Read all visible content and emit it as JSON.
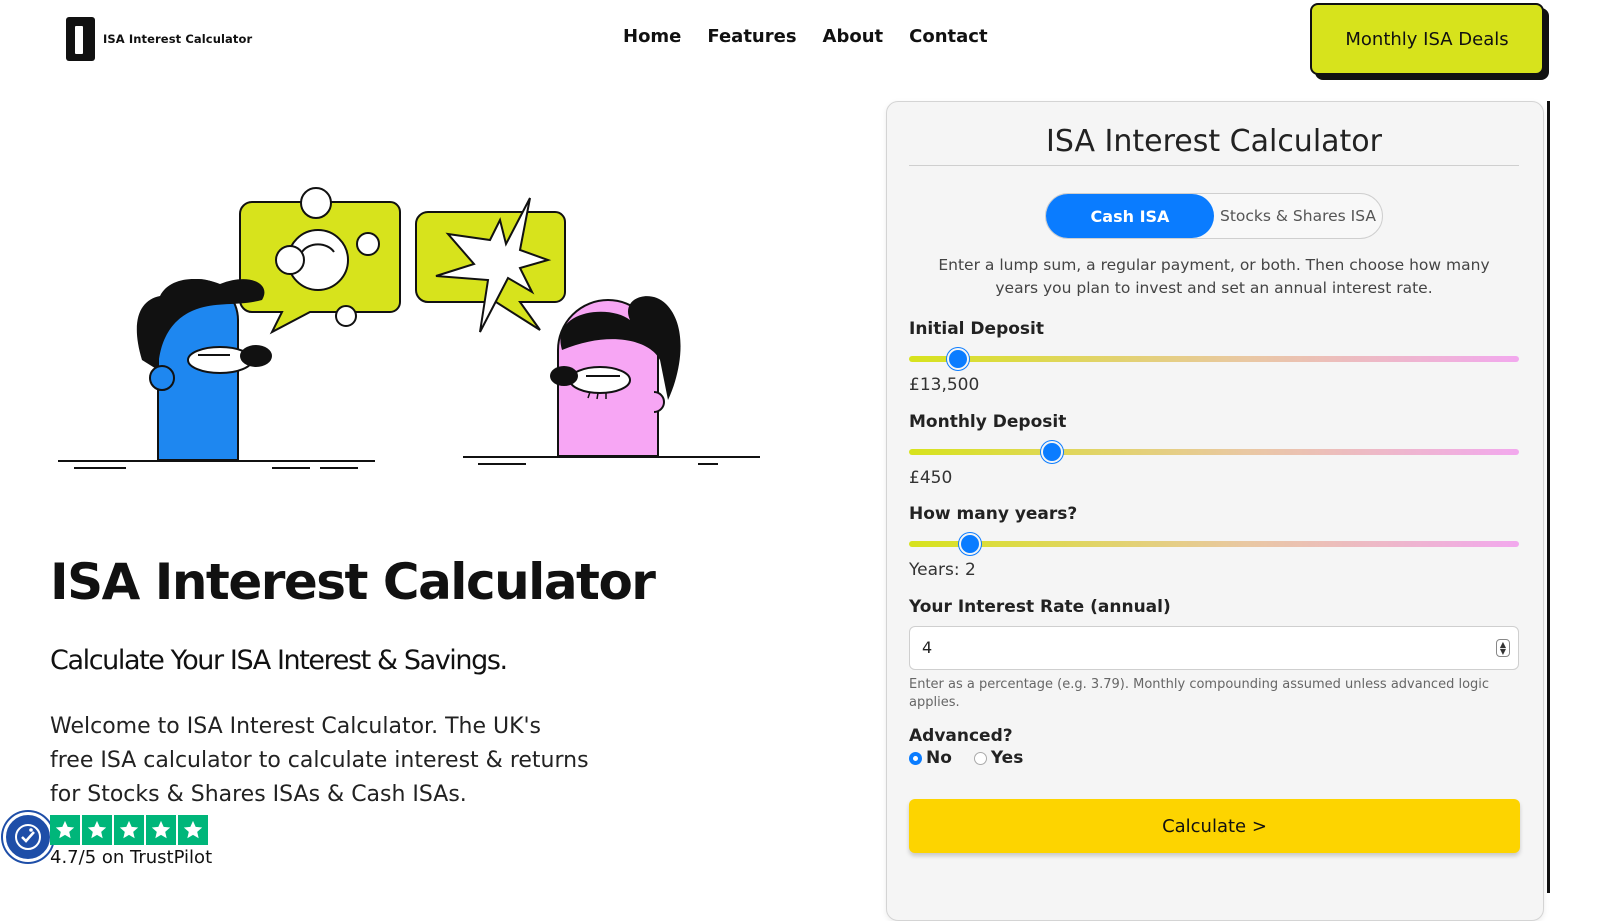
{
  "header": {
    "logo_text": "ISA Interest Calculator",
    "nav": [
      "Home",
      "Features",
      "About",
      "Contact"
    ],
    "cta_label": "Monthly ISA Deals"
  },
  "hero": {
    "title": "ISA Interest Calculator",
    "subtitle": "Calculate Your ISA Interest & Savings.",
    "body": "Welcome to ISA Interest Calculator. The UK's free ISA calculator to calculate interest & returns for Stocks & Shares ISAs & Cash ISAs."
  },
  "trust": {
    "stars": 5,
    "text": "4.7/5 on TrustPilot"
  },
  "calculator": {
    "title": "ISA Interest Calculator",
    "tabs": [
      {
        "label": "Cash ISA",
        "active": true
      },
      {
        "label": "Stocks & Shares ISA",
        "active": false
      }
    ],
    "intro": "Enter a lump sum, a regular payment, or both. Then choose how many years you plan to invest and set an annual interest rate.",
    "initial_deposit": {
      "label": "Initial Deposit",
      "value_text": "£13,500",
      "slider_fraction": 0.08
    },
    "monthly_deposit": {
      "label": "Monthly Deposit",
      "value_text": "£450",
      "slider_fraction": 0.235
    },
    "years": {
      "label": "How many years?",
      "value_text": "Years: 2",
      "slider_fraction": 0.1
    },
    "interest_rate": {
      "label": "Your Interest Rate (annual)",
      "value": "4",
      "help": "Enter as a percentage (e.g. 3.79). Monthly compounding assumed unless advanced logic applies."
    },
    "advanced": {
      "label": "Advanced?",
      "options": [
        {
          "label": "No",
          "checked": true
        },
        {
          "label": "Yes",
          "checked": false
        }
      ]
    },
    "submit_label": "Calculate >"
  },
  "colors": {
    "accent_blue": "#0a7cff",
    "lime": "#d7e31c",
    "pink": "#f7a6f4",
    "calculate_yellow": "#fdd400",
    "trustpilot_green": "#00b67a"
  }
}
